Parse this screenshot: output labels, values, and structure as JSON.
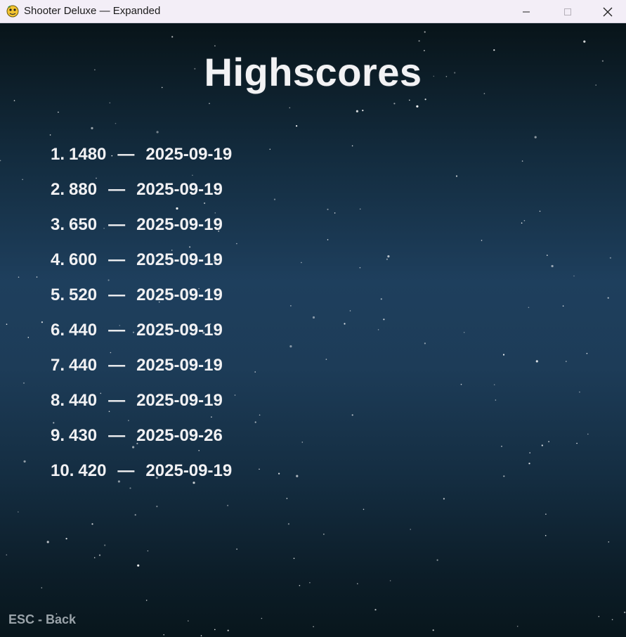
{
  "window": {
    "title": "Shooter Deluxe — Expanded",
    "icon": "pygame-snake-icon"
  },
  "screen": {
    "heading": "Highscores",
    "separator": "—",
    "scores": [
      {
        "rank": "1.",
        "score": "1480",
        "date": "2025-09-19"
      },
      {
        "rank": "2.",
        "score": "880",
        "date": "2025-09-19"
      },
      {
        "rank": "3.",
        "score": "650",
        "date": "2025-09-19"
      },
      {
        "rank": "4.",
        "score": "600",
        "date": "2025-09-19"
      },
      {
        "rank": "5.",
        "score": "520",
        "date": "2025-09-19"
      },
      {
        "rank": "6.",
        "score": "440",
        "date": "2025-09-19"
      },
      {
        "rank": "7.",
        "score": "440",
        "date": "2025-09-19"
      },
      {
        "rank": "8.",
        "score": "440",
        "date": "2025-09-19"
      },
      {
        "rank": "9.",
        "score": "430",
        "date": "2025-09-26"
      },
      {
        "rank": "10.",
        "score": "420",
        "date": "2025-09-19"
      }
    ],
    "footer_hint": "ESC - Back"
  },
  "colors": {
    "text": "#f1f1f3",
    "hint": "#9aa3a9",
    "sky_top": "#081419",
    "sky_mid": "#1e3f5d"
  }
}
